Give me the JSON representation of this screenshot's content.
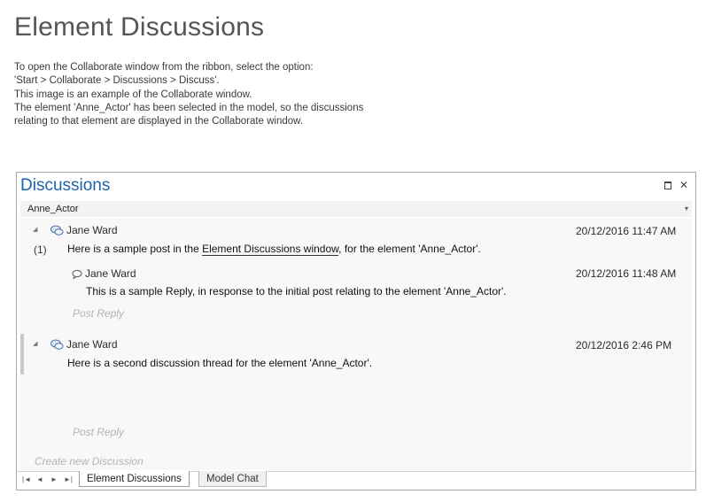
{
  "page": {
    "title": "Element Discussions",
    "intro_lines": [
      "To open the Collaborate window from the ribbon, select the option:",
      "'Start > Collaborate > Discussions > Discuss'.",
      "This image is an example of the Collaborate window.",
      "The element 'Anne_Actor' has been selected in the model, so the discussions",
      "relating to that element are displayed in the Collaborate window."
    ]
  },
  "window": {
    "title": "Discussions",
    "maximize_icon": "maximize-icon",
    "close_glyph": "✕",
    "element_name": "Anne_Actor",
    "dropdown_glyph": "▾"
  },
  "threads": [
    {
      "author": "Jane Ward",
      "timestamp": "20/12/2016 11:47 AM",
      "count": "(1)",
      "text_before": "Here is a sample post in the ",
      "text_link": "Element Discussions window",
      "text_after": ", for the element 'Anne_Actor'.",
      "reply": {
        "author": "Jane Ward",
        "timestamp": "20/12/2016 11:48 AM",
        "text": "This is a sample Reply, in response to the initial post relating to the element 'Anne_Actor'."
      },
      "post_reply": "Post Reply"
    },
    {
      "author": "Jane Ward",
      "timestamp": "20/12/2016 2:46 PM",
      "text": "Here is a second discussion thread for the element 'Anne_Actor'.",
      "post_reply": "Post Reply"
    }
  ],
  "create_new": "Create new Discussion",
  "tabs": {
    "nav": [
      "|◄",
      "◄",
      "►",
      "►|"
    ],
    "items": [
      {
        "label": "Element Discussions",
        "active": true
      },
      {
        "label": "Model Chat",
        "active": false
      }
    ]
  },
  "colors": {
    "title_blue": "#1d62ad",
    "ghost_text": "#b3b3b3"
  }
}
